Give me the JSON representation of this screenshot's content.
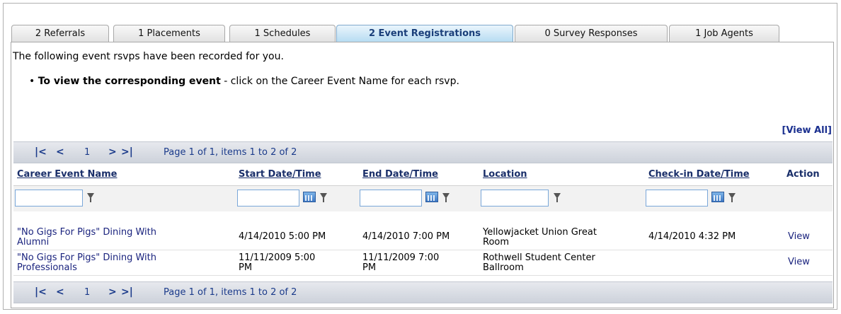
{
  "tabs": [
    {
      "label": "2 Referrals",
      "active": false
    },
    {
      "label": "1 Placements",
      "active": false
    },
    {
      "label": "1 Schedules",
      "active": false
    },
    {
      "label": "2 Event Registrations",
      "active": true
    },
    {
      "label": "0 Survey Responses",
      "active": false
    },
    {
      "label": "1 Job Agents",
      "active": false
    }
  ],
  "intro": "The following event rsvps have been recorded for you.",
  "bullet": {
    "bold": "To view the corresponding event",
    "rest": " - click on the Career Event Name for each rsvp."
  },
  "view_all": "[View All]",
  "pager": {
    "first": "|<",
    "prev": "<",
    "page": "1",
    "next": ">",
    "last": ">|",
    "info": "Page 1 of 1, items 1 to 2 of 2"
  },
  "columns": {
    "name": "Career Event Name",
    "start": "Start Date/Time",
    "end": "End Date/Time",
    "location": "Location",
    "checkin": "Check-in Date/Time",
    "action": "Action"
  },
  "rows": [
    {
      "name_1": "\"No Gigs For Pigs\" Dining With",
      "name_2": "Alumni",
      "start_1": "4/14/2010 5:00 PM",
      "start_2": "",
      "end_1": "4/14/2010 7:00 PM",
      "end_2": "",
      "location_1": "Yellowjacket Union Great",
      "location_2": "Room",
      "checkin": "4/14/2010 4:32 PM",
      "action": "View"
    },
    {
      "name_1": "\"No Gigs For Pigs\" Dining With",
      "name_2": "Professionals",
      "start_1": "11/11/2009 5:00",
      "start_2": "PM",
      "end_1": "11/11/2009 7:00",
      "end_2": "PM",
      "location_1": "Rothwell Student Center",
      "location_2": "Ballroom",
      "checkin": "",
      "action": "View"
    }
  ],
  "icons": {
    "calendar": "calendar-icon",
    "filter": "filter-icon"
  },
  "colors": {
    "link": "#1a237e",
    "active_tab": "#1a3f7a"
  }
}
